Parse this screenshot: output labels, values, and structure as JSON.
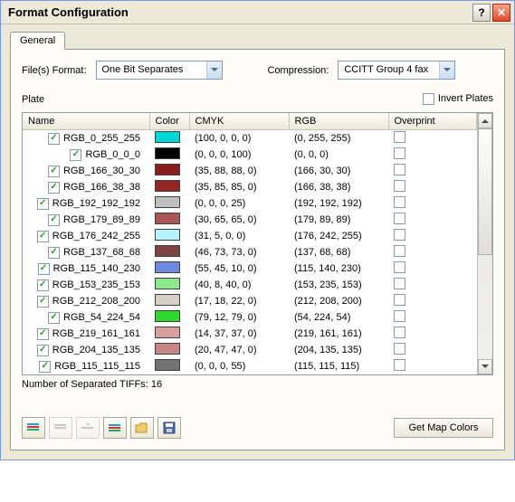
{
  "window": {
    "title": "Format Configuration"
  },
  "tabs": {
    "general": "General"
  },
  "form": {
    "files_format_label": "File(s) Format:",
    "files_format_value": "One Bit Separates",
    "compression_label": "Compression:",
    "compression_value": "CCITT Group 4 fax"
  },
  "plate": {
    "label": "Plate",
    "invert_label": "Invert Plates",
    "invert_checked": false
  },
  "table": {
    "headers": {
      "name": "Name",
      "color": "Color",
      "cmyk": "CMYK",
      "rgb": "RGB",
      "overprint": "Overprint"
    },
    "rows": [
      {
        "checked": true,
        "name": "RGB_0_255_255",
        "color": "#00d7d7",
        "cmyk": "(100, 0, 0, 0)",
        "rgb": "(0, 255, 255)",
        "overprint": false
      },
      {
        "checked": true,
        "name": "RGB_0_0_0",
        "color": "#000000",
        "cmyk": "(0, 0, 0, 100)",
        "rgb": "(0, 0, 0)",
        "overprint": false
      },
      {
        "checked": true,
        "name": "RGB_166_30_30",
        "color": "#8a1c1c",
        "cmyk": "(35, 88, 88, 0)",
        "rgb": "(166, 30, 30)",
        "overprint": false
      },
      {
        "checked": true,
        "name": "RGB_166_38_38",
        "color": "#932525",
        "cmyk": "(35, 85, 85, 0)",
        "rgb": "(166, 38, 38)",
        "overprint": false
      },
      {
        "checked": true,
        "name": "RGB_192_192_192",
        "color": "#c0c0c0",
        "cmyk": "(0, 0, 0, 25)",
        "rgb": "(192, 192, 192)",
        "overprint": false
      },
      {
        "checked": true,
        "name": "RGB_179_89_89",
        "color": "#a95656",
        "cmyk": "(30, 65, 65, 0)",
        "rgb": "(179, 89, 89)",
        "overprint": false
      },
      {
        "checked": true,
        "name": "RGB_176_242_255",
        "color": "#b7f3ff",
        "cmyk": "(31, 5, 0, 0)",
        "rgb": "(176, 242, 255)",
        "overprint": false
      },
      {
        "checked": true,
        "name": "RGB_137_68_68",
        "color": "#7f4444",
        "cmyk": "(46, 73, 73, 0)",
        "rgb": "(137, 68, 68)",
        "overprint": false
      },
      {
        "checked": true,
        "name": "RGB_115_140_230",
        "color": "#6e8ae0",
        "cmyk": "(55, 45, 10, 0)",
        "rgb": "(115, 140, 230)",
        "overprint": false
      },
      {
        "checked": true,
        "name": "RGB_153_235_153",
        "color": "#8de88d",
        "cmyk": "(40, 8, 40, 0)",
        "rgb": "(153, 235, 153)",
        "overprint": false
      },
      {
        "checked": true,
        "name": "RGB_212_208_200",
        "color": "#d4d0c8",
        "cmyk": "(17, 18, 22, 0)",
        "rgb": "(212, 208, 200)",
        "overprint": false
      },
      {
        "checked": true,
        "name": "RGB_54_224_54",
        "color": "#2fd82f",
        "cmyk": "(79, 12, 79, 0)",
        "rgb": "(54, 224, 54)",
        "overprint": false
      },
      {
        "checked": true,
        "name": "RGB_219_161_161",
        "color": "#d9a0a0",
        "cmyk": "(14, 37, 37, 0)",
        "rgb": "(219, 161, 161)",
        "overprint": false
      },
      {
        "checked": true,
        "name": "RGB_204_135_135",
        "color": "#c68686",
        "cmyk": "(20, 47, 47, 0)",
        "rgb": "(204, 135, 135)",
        "overprint": false
      },
      {
        "checked": true,
        "name": "RGB_115_115_115",
        "color": "#737373",
        "cmyk": "(0, 0, 0, 55)",
        "rgb": "(115, 115, 115)",
        "overprint": false
      }
    ]
  },
  "footer": {
    "separated_tiffs": "Number of Separated TIFFs: 16"
  },
  "buttons": {
    "get_map_colors": "Get Map Colors"
  }
}
